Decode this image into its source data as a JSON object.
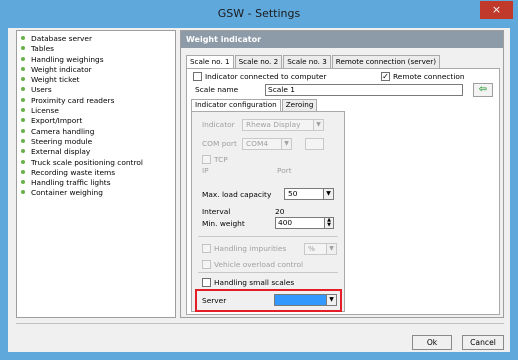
{
  "window": {
    "title": "GSW - Settings",
    "close_glyph": "×"
  },
  "sidebar": {
    "items": [
      "Database server",
      "Tables",
      "Handling weighings",
      "Weight indicator",
      "Weight ticket",
      "Users",
      "Proximity card readers",
      "License",
      "Export/Import",
      "Camera handling",
      "Steering module",
      "External display",
      "Truck scale positioning control",
      "Recording waste items",
      "Handling traffic lights",
      "Container weighing"
    ],
    "bullet_color": "#6ab04c"
  },
  "panel": {
    "header": "Weight indicator",
    "tabs": [
      "Scale no. 1",
      "Scale no. 2",
      "Scale no. 3",
      "Remote connection (server)"
    ],
    "indicator_connected_label": "Indicator connected to computer",
    "indicator_connected_checked": false,
    "remote_connection_label": "Remote connection",
    "remote_connection_checked": true,
    "scale_name_label": "Scale name",
    "scale_name_value": "Scale 1",
    "arrow_glyph": "⇦",
    "subtabs": [
      "Indicator configuration",
      "Zeroing"
    ],
    "config": {
      "indicator_label": "Indicator",
      "indicator_value": "Rhewa Display",
      "com_port_label": "COM port",
      "com_port_value": "COM4",
      "tcp_label": "TCP",
      "ip_label": "IP",
      "port_label": "Port",
      "max_load_label": "Max. load capacity",
      "max_load_value": "50",
      "interval_label": "Interval",
      "interval_value": "20",
      "min_weight_label": "Min. weight",
      "min_weight_value": "400",
      "handling_impurities_label": "Handling impurities",
      "percent_value": "%",
      "vehicle_overload_label": "Vehicle overload control",
      "handling_small_scales_label": "Handling small scales",
      "server_label": "Server",
      "server_value": ""
    }
  },
  "buttons": {
    "ok": "Ok",
    "cancel": "Cancel"
  },
  "colors": {
    "titlebar": "#5fa8dc",
    "close": "#c0392b",
    "header": "#8d9aa8",
    "highlight": "#e41e26",
    "selection": "#3399ff"
  }
}
